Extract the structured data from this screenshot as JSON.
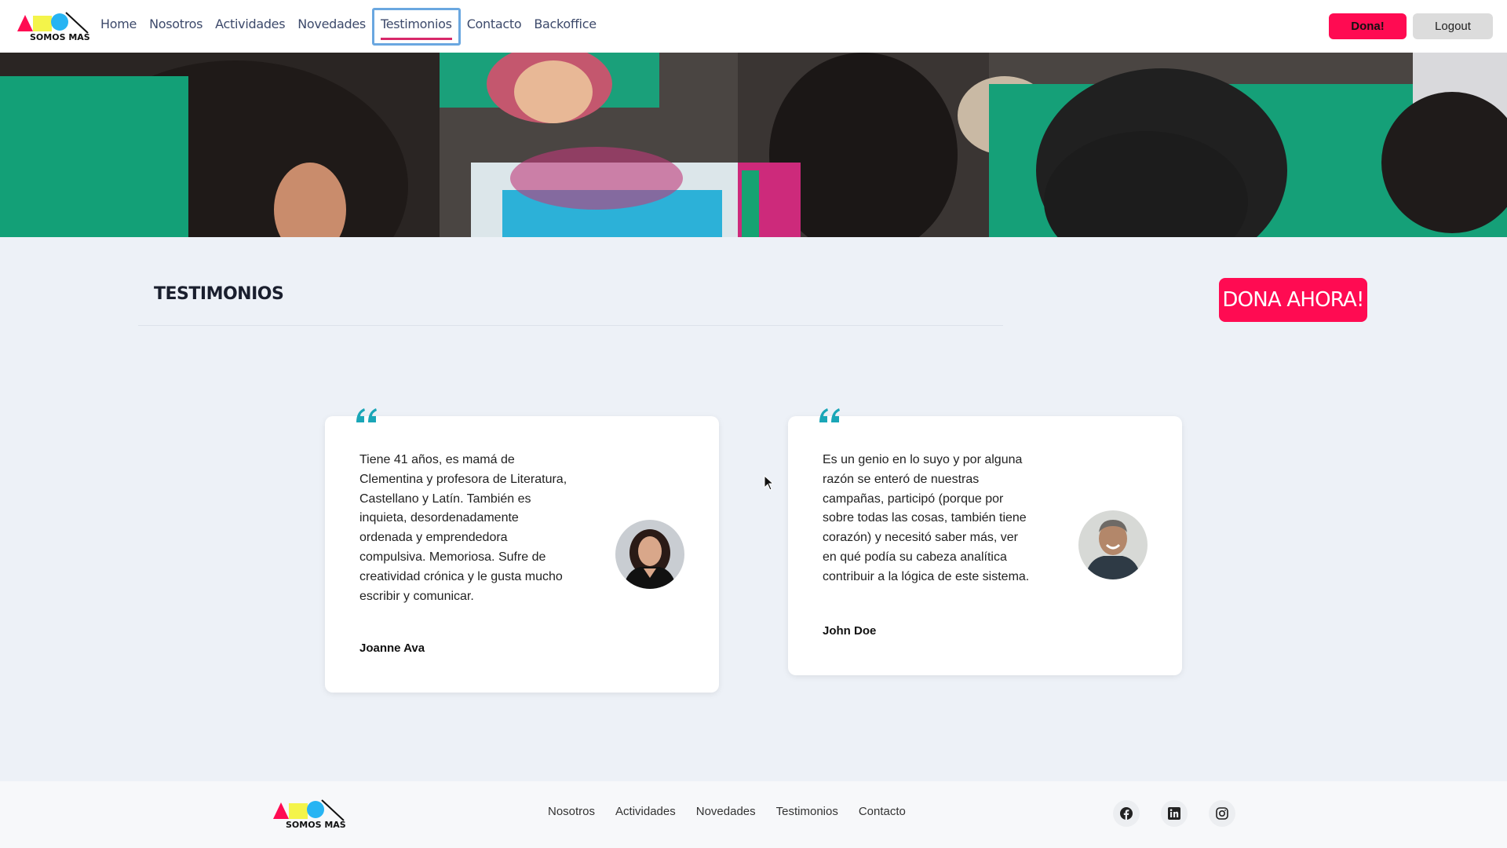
{
  "header": {
    "logo_text": "SOMOS MAS",
    "nav": [
      {
        "label": "Home"
      },
      {
        "label": "Nosotros"
      },
      {
        "label": "Actividades"
      },
      {
        "label": "Novedades"
      },
      {
        "label": "Testimonios",
        "active": true
      },
      {
        "label": "Contacto"
      },
      {
        "label": "Backoffice"
      }
    ],
    "dona_label": "Dona!",
    "logout_label": "Logout"
  },
  "hero": {
    "image": "hero-kids-drawing-photo"
  },
  "main": {
    "title": "TESTIMONIOS",
    "dona_ahora_label": "DONA AHORA!"
  },
  "testimonials": [
    {
      "text": "Tiene 41 años, es mamá de Clementina y profesora de Literatura, Castellano y Latín. También es inquieta, desordenadamente ordenada y emprendedora compulsiva. Memoriosa. Sufre de creatividad crónica y le gusta mucho escribir y comunicar.",
      "author": "Joanne Ava"
    },
    {
      "text": "Es un genio en lo suyo y por alguna razón se enteró de nuestras campañas, participó (porque por sobre todas las cosas, también tiene corazón) y necesitó saber más, ver en qué podía su cabeza analítica contribuir a la lógica de este sistema.",
      "author": "John Doe"
    }
  ],
  "footer": {
    "logo_text": "SOMOS MAS",
    "links": [
      {
        "label": "Nosotros"
      },
      {
        "label": "Actividades"
      },
      {
        "label": "Novedades"
      },
      {
        "label": "Testimonios"
      },
      {
        "label": "Contacto"
      }
    ],
    "social": [
      "facebook-icon",
      "linkedin-icon",
      "instagram-icon"
    ]
  },
  "colors": {
    "accent": "#ff0b52",
    "background": "#edf1f7",
    "quote": "#1aa6b7",
    "nav_text": "#3d4a6b"
  }
}
